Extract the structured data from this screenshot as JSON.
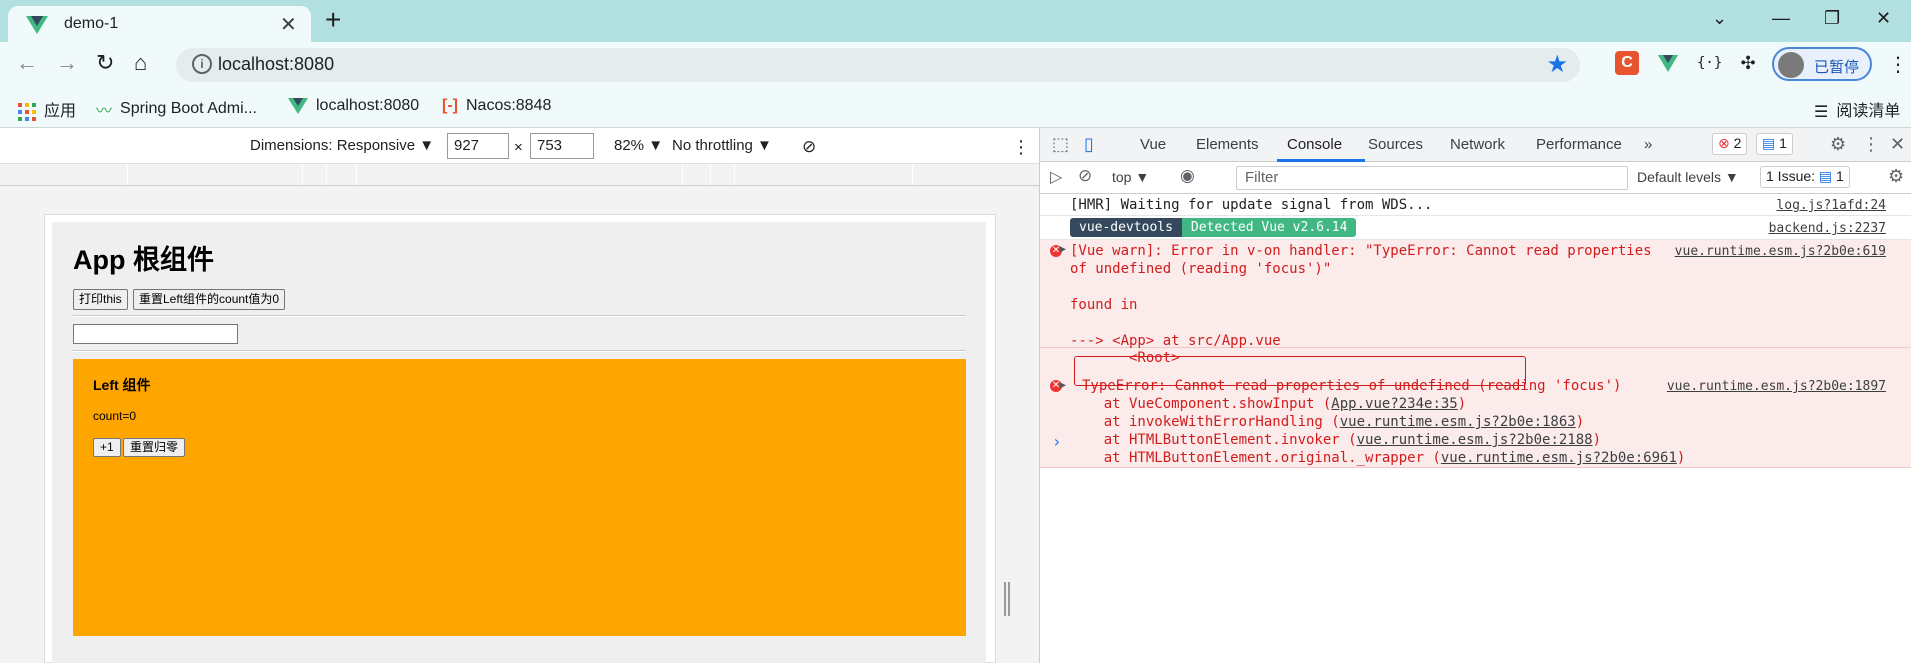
{
  "browser": {
    "tab_title": "demo-1",
    "url": "localhost:8080",
    "profile_label": "已暂停",
    "bookmarks": [
      "应用",
      "Spring Boot Admi...",
      "localhost:8080",
      "Nacos:8848"
    ],
    "reading_list": "阅读清单"
  },
  "device_toolbar": {
    "dimensions": "Dimensions: Responsive",
    "width": "927",
    "height": "753",
    "times": "×",
    "zoom": "82%",
    "throttling": "No throttling"
  },
  "app": {
    "title": "App 根组件",
    "btn_print": "打印this",
    "btn_reset": "重置Left组件的count值为0",
    "left": {
      "title": "Left 组件",
      "count": "count=0",
      "btn_plus": "+1",
      "btn_zero": "重置归零"
    }
  },
  "devtools": {
    "tabs": [
      "Vue",
      "Elements",
      "Console",
      "Sources",
      "Network",
      "Performance"
    ],
    "more": "»",
    "error_count": "2",
    "info_count": "1",
    "context": "top",
    "filter_placeholder": "Filter",
    "levels": "Default levels",
    "issues": "1 Issue:",
    "issues_count": "1",
    "messages": {
      "hmr": "[HMR] Waiting for update signal from WDS...",
      "hmr_src": "log.js?1afd:24",
      "vtag1": "vue-devtools",
      "vtag2": "Detected Vue v2.6.14",
      "vtag_src": "backend.js:2237",
      "warn_line1": "[Vue warn]: Error in v-on handler: \"TypeError: Cannot read properties",
      "warn_line2": "of undefined (reading 'focus')\"",
      "warn_line3": "found in",
      "warn_line4": "---> <App> at src/App.vue",
      "warn_line5": "       <Root>",
      "warn_src": "vue.runtime.esm.js?2b0e:619",
      "type_error": "TypeError: Cannot read properties of undefined (reading 'focus')",
      "type_error_src": "vue.runtime.esm.js?2b0e:1897",
      "stack": [
        {
          "text": "    at VueComponent.showInput (",
          "link": "App.vue?234e:35",
          "end": ")"
        },
        {
          "text": "    at invokeWithErrorHandling (",
          "link": "vue.runtime.esm.js?2b0e:1863",
          "end": ")"
        },
        {
          "text": "    at HTMLButtonElement.invoker (",
          "link": "vue.runtime.esm.js?2b0e:2188",
          "end": ")"
        },
        {
          "text": "    at HTMLButtonElement.original._wrapper (",
          "link": "vue.runtime.esm.js?2b0e:6961",
          "end": ")"
        }
      ]
    }
  },
  "colors": {
    "vue_green": "#41b883",
    "vue_dark": "#35495e",
    "left_bg": "#ffa500",
    "error": "#d21c1c"
  }
}
